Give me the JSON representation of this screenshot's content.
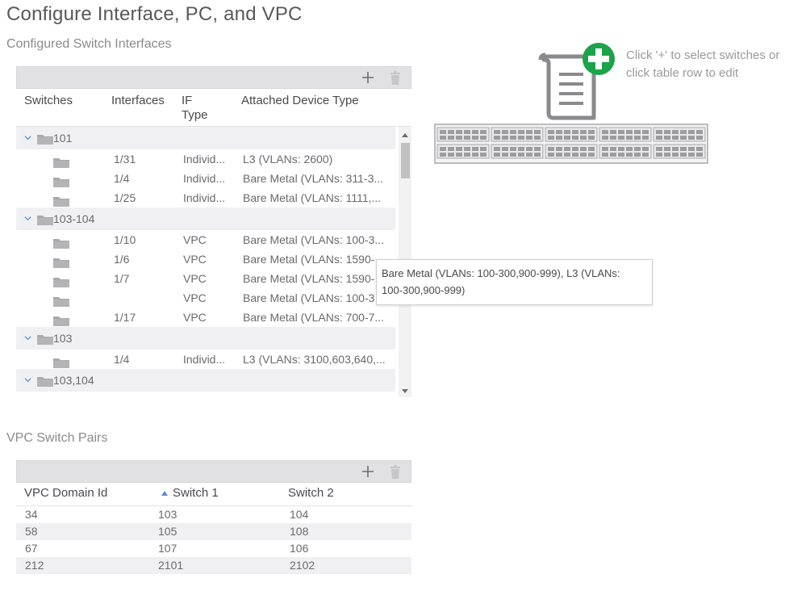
{
  "page": {
    "title": "Configure Interface, PC, and VPC"
  },
  "switch_interfaces": {
    "section_title": "Configured Switch Interfaces",
    "columns": [
      "Switches",
      "Interfaces",
      "IF\nType",
      "Attached Device Type"
    ],
    "col_if_type_1": "IF",
    "col_if_type_2": "Type",
    "groups": [
      {
        "name": "101",
        "rows": [
          {
            "iface": "1/31",
            "type": "Individ...",
            "device": "L3 (VLANs: 2600)"
          },
          {
            "iface": "1/4",
            "type": "Individ...",
            "device": "Bare Metal (VLANs: 311-3..."
          },
          {
            "iface": "1/25",
            "type": "Individ...",
            "device": "Bare Metal (VLANs: 1111,..."
          }
        ]
      },
      {
        "name": "103-104",
        "rows": [
          {
            "iface": "1/10",
            "type": "VPC",
            "device": "Bare Metal (VLANs: 100-3..."
          },
          {
            "iface": "1/6",
            "type": "VPC",
            "device": "Bare Metal (VLANs: 1590-"
          },
          {
            "iface": "1/7",
            "type": "VPC",
            "device": "Bare Metal (VLANs: 1590-"
          },
          {
            "iface": "",
            "type": "VPC",
            "device": "Bare Metal (VLANs: 100-3"
          },
          {
            "iface": "1/17",
            "type": "VPC",
            "device": "Bare Metal (VLANs: 700-7..."
          }
        ]
      },
      {
        "name": "103",
        "rows": [
          {
            "iface": "1/4",
            "type": "Individ...",
            "device": "L3 (VLANs: 3100,603,640,..."
          }
        ]
      },
      {
        "name": "103,104",
        "rows": []
      }
    ],
    "tooltip_line1": "Bare Metal (VLANs: 100-300,900-999), L3 (VLANs:",
    "tooltip_line2": "100-300,900-999)"
  },
  "vpc_pairs": {
    "section_title": "VPC Switch Pairs",
    "col_domain": "VPC Domain Id",
    "col_switch1": "Switch 1",
    "col_switch2": "Switch 2",
    "rows": [
      {
        "domain": "34",
        "s1": "103",
        "s2": "104"
      },
      {
        "domain": "58",
        "s1": "105",
        "s2": "108"
      },
      {
        "domain": "67",
        "s1": "107",
        "s2": "106"
      },
      {
        "domain": "212",
        "s1": "2101",
        "s2": "2102"
      }
    ]
  },
  "hint": {
    "line1": "Click '+' to select switches or",
    "line2": "click table row to edit"
  },
  "icons": {
    "add": "plus-icon",
    "delete": "trash-icon",
    "folder": "folder-icon",
    "expand": "chevron-down-icon",
    "sort": "sort-asc-icon",
    "scroll": "scroll-document-icon",
    "switch": "switch-device-icon",
    "add_badge": "add-circle-icon"
  },
  "colors": {
    "accent_green": "#1ba34a",
    "toolbar_bg": "#e1e1e3",
    "row_alt": "#f0f0f2"
  }
}
